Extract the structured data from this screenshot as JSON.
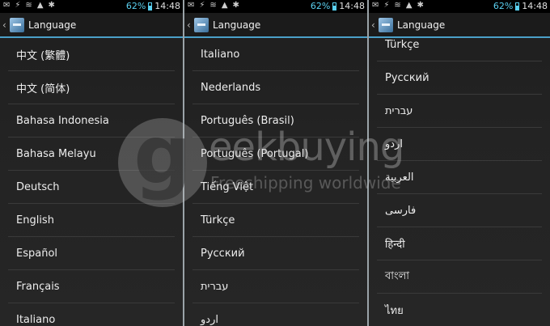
{
  "status_bar": {
    "battery_percent": "62%",
    "time": "14:48",
    "icons": [
      "notification-icon",
      "usb-icon",
      "wifi-icon",
      "sd-icon",
      "warning-icon",
      "bug-icon"
    ]
  },
  "action_bar": {
    "title": "Language"
  },
  "panel1": {
    "items": [
      "中文 (繁體)",
      "中文 (简体)",
      "Bahasa Indonesia",
      "Bahasa Melayu",
      "Deutsch",
      "English",
      "Español",
      "Français",
      "Italiano"
    ]
  },
  "panel2": {
    "items": [
      "Italiano",
      "Nederlands",
      "Português (Brasil)",
      "Português (Portugal)",
      "Tiếng Việt",
      "Türkçe",
      "Русский",
      "עברית",
      "اردو"
    ]
  },
  "panel3": {
    "items": [
      "Türkçe",
      "Русский",
      "עברית",
      "اردو",
      "العربية",
      "فارسی",
      "हिन्दी",
      "বাংলা",
      "ไทย"
    ]
  },
  "watermark": {
    "letter": "g",
    "brand": "eekbuying",
    "tagline": "Freeshipping worldwide"
  },
  "colors": {
    "accent": "#4aa0c8",
    "background": "#222222",
    "text": "#ededed"
  }
}
